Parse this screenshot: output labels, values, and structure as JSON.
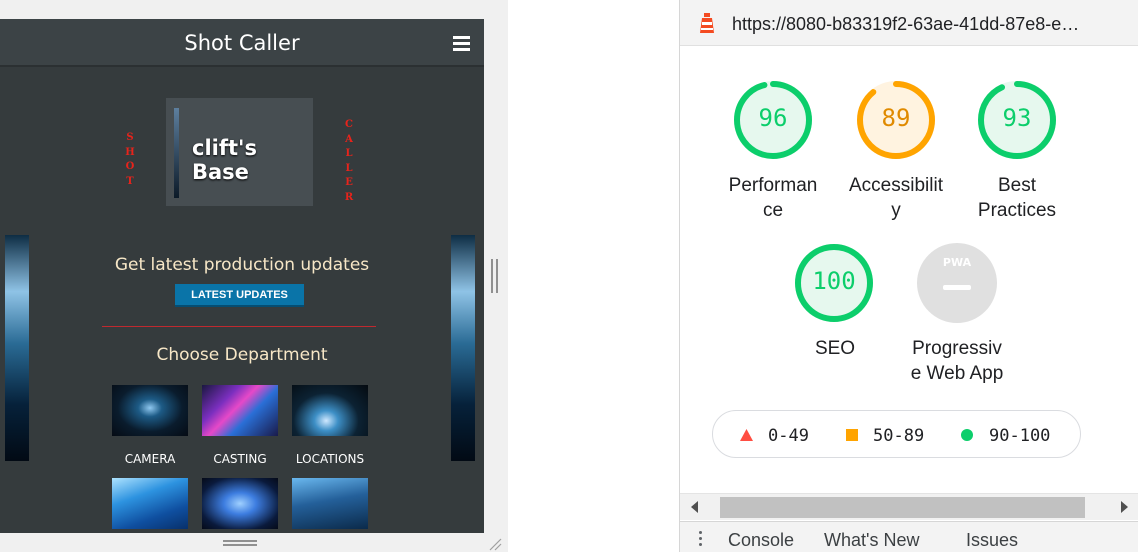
{
  "device": {
    "app_title": "Shot Caller",
    "brand_left_letters": [
      "S",
      "H",
      "O",
      "T"
    ],
    "brand_right_letters": [
      "C",
      "A",
      "L",
      "L",
      "E",
      "R"
    ],
    "base_name": "clift's Base",
    "updates_text": "Get latest production updates",
    "latest_button": "LATEST UPDATES",
    "department_title": "Choose Department",
    "departments": [
      {
        "label": "CAMERA"
      },
      {
        "label": "CASTING"
      },
      {
        "label": "LOCATIONS"
      },
      {
        "label": ""
      },
      {
        "label": ""
      },
      {
        "label": ""
      }
    ]
  },
  "devtools": {
    "url": "https://8080-b83319f2-63ae-41dd-87e8-e…",
    "scores": [
      {
        "value": "96",
        "label": "Performance",
        "color": "#0cce6b",
        "fill": 0.96
      },
      {
        "value": "89",
        "label": "Accessibility",
        "color": "#ffa400",
        "fill": 0.89
      },
      {
        "value": "93",
        "label": "Best Practices",
        "color": "#0cce6b",
        "fill": 0.93
      },
      {
        "value": "100",
        "label": "SEO",
        "color": "#0cce6b",
        "fill": 1.0
      },
      {
        "value": "PWA",
        "label": "Progressive Web App",
        "color": "#9e9e9e",
        "fill": 0
      }
    ],
    "legend": [
      {
        "range": "0-49",
        "color": "#ff4e42",
        "shape": "triangle"
      },
      {
        "range": "50-89",
        "color": "#ffa400",
        "shape": "square"
      },
      {
        "range": "90-100",
        "color": "#0cce6b",
        "shape": "circle"
      }
    ],
    "drawer_tabs": [
      "Console",
      "What's New",
      "Issues"
    ]
  }
}
